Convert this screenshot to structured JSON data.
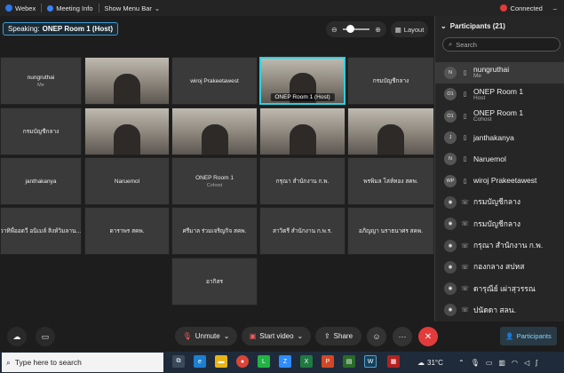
{
  "topbar": {
    "app_name": "Webex",
    "meeting_info": "Meeting Info",
    "show_menu_bar": "Show Menu Bar",
    "status": "Connected"
  },
  "speaking": {
    "prefix": "Speaking:",
    "name": "ONEP Room 1 (Host)"
  },
  "view": {
    "layout_label": "Layout"
  },
  "tiles": [
    {
      "name": "nungruthai",
      "sub": "Me",
      "video": false
    },
    {
      "name": "",
      "sub": "",
      "video": true
    },
    {
      "name": "wiroj Prakeetawest",
      "sub": "",
      "video": false
    },
    {
      "name": "ONEP Room 1 (Host)",
      "sub": "",
      "video": true,
      "active": true
    },
    {
      "name": "กรมบัญชีกลาง",
      "sub": "",
      "video": false
    },
    {
      "name": "กรมบัญชีกลาง",
      "sub": "",
      "video": false
    },
    {
      "name": "",
      "sub": "",
      "video": true
    },
    {
      "name": "",
      "sub": "",
      "video": true
    },
    {
      "name": "",
      "sub": "",
      "video": true
    },
    {
      "name": "",
      "sub": "",
      "video": true
    },
    {
      "name": "janthakanya",
      "sub": "",
      "video": false
    },
    {
      "name": "Naruemol",
      "sub": "",
      "video": false
    },
    {
      "name": "ONEP Room 1",
      "sub": "Cohost",
      "video": false
    },
    {
      "name": "กรุณา สำนักงาน ก.พ.",
      "sub": "",
      "video": false
    },
    {
      "name": "พรพิมล โล่ห์ทอง สคพ.",
      "sub": "",
      "video": false
    },
    {
      "name": "วาทิพื่ออดวี อนิเมล์ สิงห์วิมลานน...",
      "sub": "",
      "video": false
    },
    {
      "name": "ดาราพร สคพ.",
      "sub": "",
      "video": false
    },
    {
      "name": "ศรีมาล ร่วมเจริญกิจ สคพ.",
      "sub": "",
      "video": false
    },
    {
      "name": "สาวิตรี สำนักงาน ก.พ.ร.",
      "sub": "",
      "video": false
    },
    {
      "name": "อภิญญา นราธนาศร สคพ.",
      "sub": "",
      "video": false
    },
    {
      "name": "อากิสร",
      "sub": "",
      "video": false
    }
  ],
  "participants": {
    "title": "Participants (21)",
    "search_placeholder": "Search",
    "list": [
      {
        "initials": "N",
        "name": "nungruthai",
        "role": "Me",
        "me": true
      },
      {
        "initials": "O1",
        "name": "ONEP Room 1",
        "role": "Host"
      },
      {
        "initials": "O1",
        "name": "ONEP Room 1",
        "role": "Cohost"
      },
      {
        "initials": "J",
        "name": "janthakanya",
        "role": ""
      },
      {
        "initials": "N",
        "name": "Naruemol",
        "role": ""
      },
      {
        "initials": "WP",
        "name": "wiroj Prakeetawest",
        "role": ""
      },
      {
        "initials": "",
        "name": "กรมบัญชีกลาง",
        "role": ""
      },
      {
        "initials": "",
        "name": "กรมบัญชีกลาง",
        "role": ""
      },
      {
        "initials": "",
        "name": "กรุณา สำนักงาน ก.พ.",
        "role": ""
      },
      {
        "initials": "",
        "name": "กองกลาง สปหส",
        "role": ""
      },
      {
        "initials": "",
        "name": "ดารุณีย์ เผ่าสุวรรณ",
        "role": ""
      },
      {
        "initials": "",
        "name": "ปนัดดา สลน.",
        "role": ""
      }
    ]
  },
  "controls": {
    "unmute": "Unmute",
    "start_video": "Start video",
    "share": "Share",
    "participants": "Participants"
  },
  "taskbar": {
    "search_placeholder": "Type here to search",
    "temperature": "31°C"
  }
}
